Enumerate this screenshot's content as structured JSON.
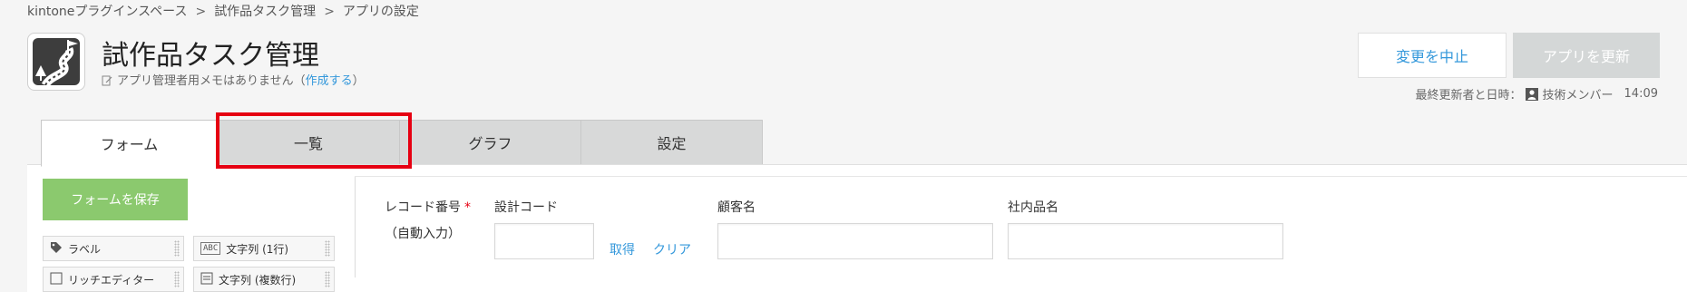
{
  "breadcrumb": {
    "items": [
      "kintoneプラグインスペース",
      "試作品タスク管理",
      "アプリの設定"
    ],
    "separator": ">"
  },
  "app": {
    "title": "試作品タスク管理",
    "memo_text": "アプリ管理者用メモはありません",
    "memo_paren_open": "（",
    "memo_link": "作成する",
    "memo_paren_close": "）"
  },
  "header": {
    "cancel_label": "変更を中止",
    "update_label": "アプリを更新",
    "updated_prefix": "最終更新者と日時：",
    "updated_user": "技術メンバー",
    "updated_time": "14:09"
  },
  "tabs": [
    {
      "label": "フォーム",
      "active": true
    },
    {
      "label": "一覧",
      "active": false
    },
    {
      "label": "グラフ",
      "active": false
    },
    {
      "label": "設定",
      "active": false
    }
  ],
  "sidebar": {
    "save_label": "フォームを保存",
    "parts": [
      {
        "label": "ラベル",
        "icon": "tag-icon"
      },
      {
        "label": "文字列 (1行)",
        "icon": "abc-icon"
      },
      {
        "label": "リッチエディター",
        "icon": "rich-editor-icon"
      },
      {
        "label": "文字列 (複数行)",
        "icon": "multiline-icon"
      }
    ]
  },
  "form": {
    "record_number_label": "レコード番号",
    "required_mark": "*",
    "auto_input_label": "（自動入力）",
    "design_code_label": "設計コード",
    "fetch_link": "取得",
    "clear_link": "クリア",
    "customer_label": "顧客名",
    "product_label": "社内品名"
  },
  "colors": {
    "accent_link": "#3498db",
    "save_button": "#8bc96e",
    "highlight": "#e60012",
    "required": "#e60012"
  }
}
